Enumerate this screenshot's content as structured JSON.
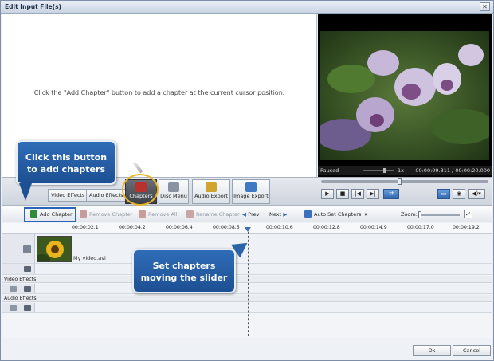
{
  "window": {
    "title": "Edit Input File(s)",
    "close_label": "✕"
  },
  "hint_text": "Click the \"Add Chapter\" button to add a chapter at the current cursor position.",
  "player": {
    "status": "Paused",
    "speed": "1x",
    "time": "00:00:09.311 / 00:00:20.000",
    "seek_fraction": 0.47
  },
  "tools": {
    "video_effects": "Video Effects",
    "audio_effects": "Audio Effects",
    "chapters": "Chapters",
    "disc_menu": "Disc Menu",
    "audio_export": "Audio Export",
    "image_export": "Image Export"
  },
  "chapter_toolbar": {
    "add": "Add Chapter",
    "remove": "Remove Chapter",
    "remove_all": "Remove All",
    "rename": "Rename Chapter",
    "prev": "Prev",
    "next": "Next",
    "auto_set": "Auto Set Chapters",
    "zoom": "Zoom:"
  },
  "ruler_ticks": [
    "00:00:02.1",
    "00:00:04.2",
    "00:00:06.4",
    "00:00:08.5",
    "00:00:10.6",
    "00:00:12.8",
    "00:00:14.9",
    "00:00:17.0",
    "00:00:19.2"
  ],
  "tracks": {
    "clip_name": "My video.avi",
    "video_effects": "Video Effects",
    "audio_effects": "Audio Effects"
  },
  "callouts": {
    "add_line1": "Click this button",
    "add_line2": "to add chapters",
    "slider_line1": "Set chapters",
    "slider_line2": "moving the slider"
  },
  "dialog": {
    "ok": "Ok",
    "cancel": "Cancel"
  },
  "colors": {
    "accent": "#2a64b8",
    "highlight": "#e7b52a"
  }
}
